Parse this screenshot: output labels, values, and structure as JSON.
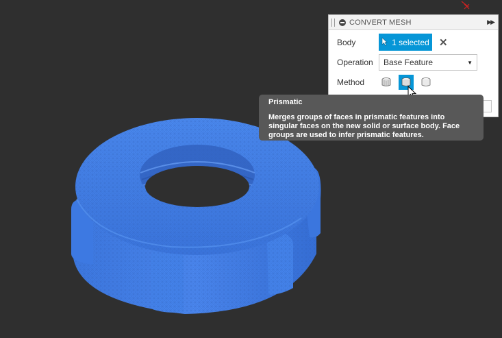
{
  "dialog": {
    "title": "CONVERT MESH",
    "body_label": "Body",
    "body_selection": "1 selected",
    "operation_label": "Operation",
    "operation_value": "Base Feature",
    "method_label": "Method",
    "method_options": [
      "faceted",
      "prismatic",
      "organic"
    ],
    "selected_method": "prismatic"
  },
  "tooltip": {
    "title": "Prismatic",
    "line1": "Merges groups of faces in prismatic features into",
    "line2": "singular faces on the new solid or surface body. Face",
    "line3": "groups are used to infer prismatic features."
  },
  "colors": {
    "viewport_bg": "#2f2f2f",
    "mesh_blue": "#3f7ee6",
    "accent": "#0696d7",
    "tooltip_bg": "#585858",
    "axis_red": "#cc2222"
  }
}
